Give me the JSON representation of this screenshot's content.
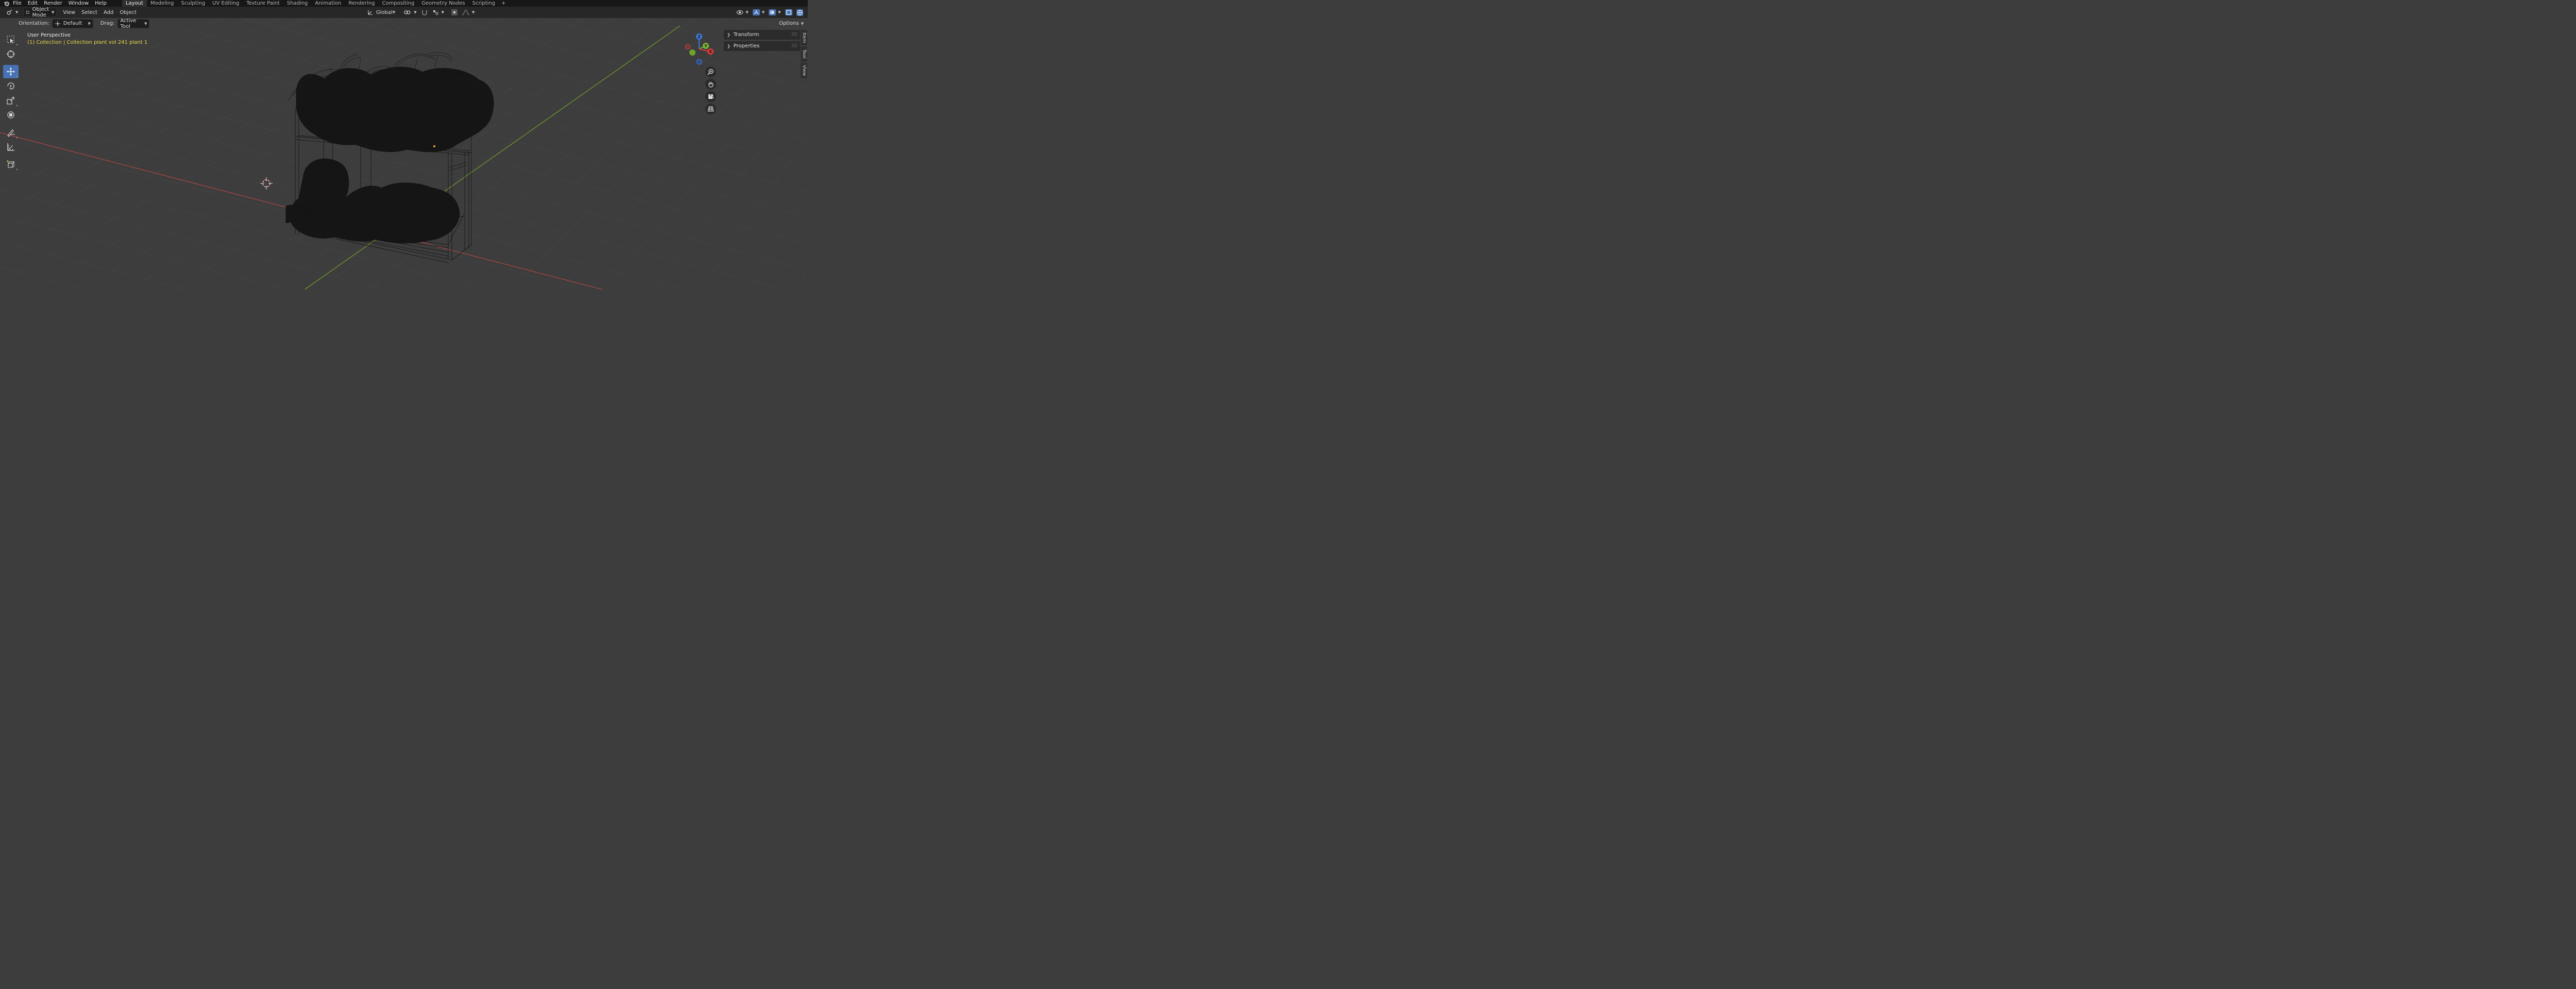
{
  "topbar": {
    "menus": [
      "File",
      "Edit",
      "Render",
      "Window",
      "Help"
    ],
    "workspaces": [
      "Layout",
      "Modeling",
      "Sculpting",
      "UV Editing",
      "Texture Paint",
      "Shading",
      "Animation",
      "Rendering",
      "Compositing",
      "Geometry Nodes",
      "Scripting"
    ],
    "active_workspace": "Layout",
    "add_tab": "+"
  },
  "header": {
    "mode": "Object Mode",
    "menus": [
      "View",
      "Select",
      "Add",
      "Object"
    ],
    "transform_orientation": "Global",
    "options_label": "Options"
  },
  "toolsettings": {
    "orientation_label": "Orientation:",
    "orientation_value": "Default",
    "drag_label": "Drag:",
    "drag_value": "Active Tool"
  },
  "viewport": {
    "perspective": "User Perspective",
    "collection_info": "(1) Collection | Collection plant vol 241 plant 1",
    "background_color": "#3d3d3d",
    "x_axis_color": "#b04a4a",
    "y_axis_color": "#7ea33a"
  },
  "toolbar": {
    "tools": [
      "select-box-icon",
      "cursor-icon",
      "move-icon",
      "rotate-icon",
      "scale-icon",
      "transform-icon",
      "annotate-icon",
      "measure-icon",
      "add-cube-icon"
    ],
    "active_tool": "move-icon"
  },
  "gizmo": {
    "labels": [
      "Z",
      "Y",
      "X"
    ]
  },
  "npanel": {
    "tabs": [
      "Item",
      "Tool",
      "View"
    ],
    "sections": [
      "Transform",
      "Properties"
    ]
  }
}
